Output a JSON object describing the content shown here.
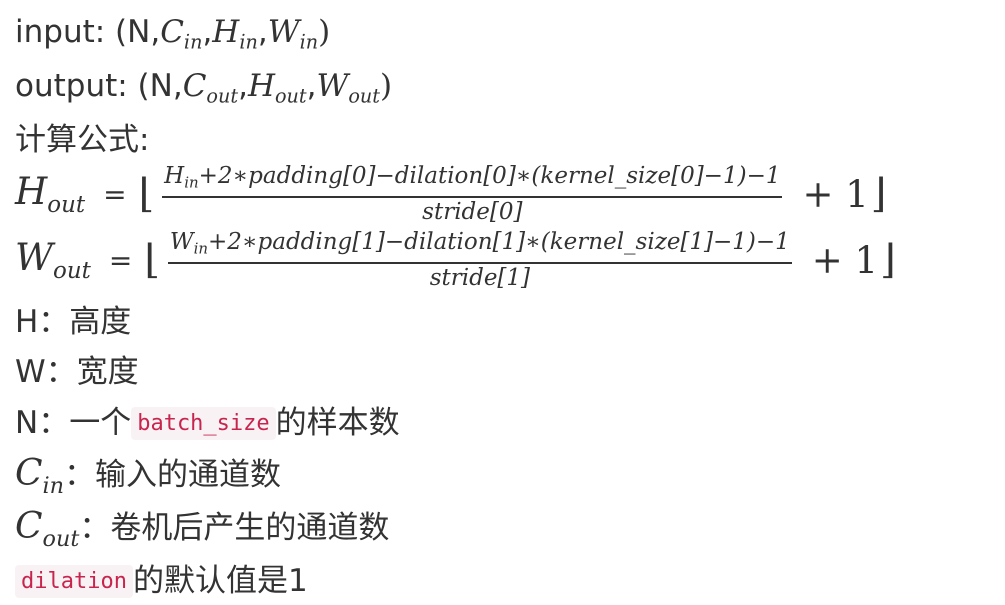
{
  "lines": {
    "input": {
      "prefix": "input: (N,",
      "c": "C",
      "h": "H",
      "w": "W",
      "sub": "in",
      "sep": ",",
      "close": ")"
    },
    "output": {
      "prefix": "output: (N,",
      "c": "C",
      "h": "H",
      "w": "W",
      "sub": "out",
      "sep": ",",
      "close": ")"
    },
    "formula_heading": "计算公式:"
  },
  "formulas": {
    "h": {
      "lhs": "H",
      "lhs_sub": "out",
      "eq": "=",
      "floor_open": "⌊",
      "floor_close": "⌋",
      "numerator_var": "H",
      "numerator_sub": "in",
      "numerator_rest": "+2∗padding[0]−dilation[0]∗(kernel_size[0]−1)−1",
      "denominator": "stride[0]",
      "plus": "+ 1"
    },
    "w": {
      "lhs": "W",
      "lhs_sub": "out",
      "eq": "=",
      "floor_open": "⌊",
      "floor_close": "⌋",
      "numerator_var": "W",
      "numerator_sub": "in",
      "numerator_rest": "+2∗padding[1]−dilation[1]∗(kernel_size[1]−1)−1",
      "denominator": "stride[1]",
      "plus": "+ 1"
    }
  },
  "definitions": {
    "h": "H：高度",
    "w": "W：宽度",
    "n_prefix": "N：一个",
    "n_code": "batch_size",
    "n_suffix": "的样本数",
    "cin_var": "C",
    "cin_sub": "in",
    "cin_text": "：输入的通道数",
    "cout_var": "C",
    "cout_sub": "out",
    "cout_text": "：卷机后产生的通道数",
    "dilation_code": "dilation",
    "dilation_text": "的默认值是1"
  },
  "colors": {
    "text": "#333333",
    "code_text": "#c7254e",
    "code_bg": "#f9f2f4"
  }
}
